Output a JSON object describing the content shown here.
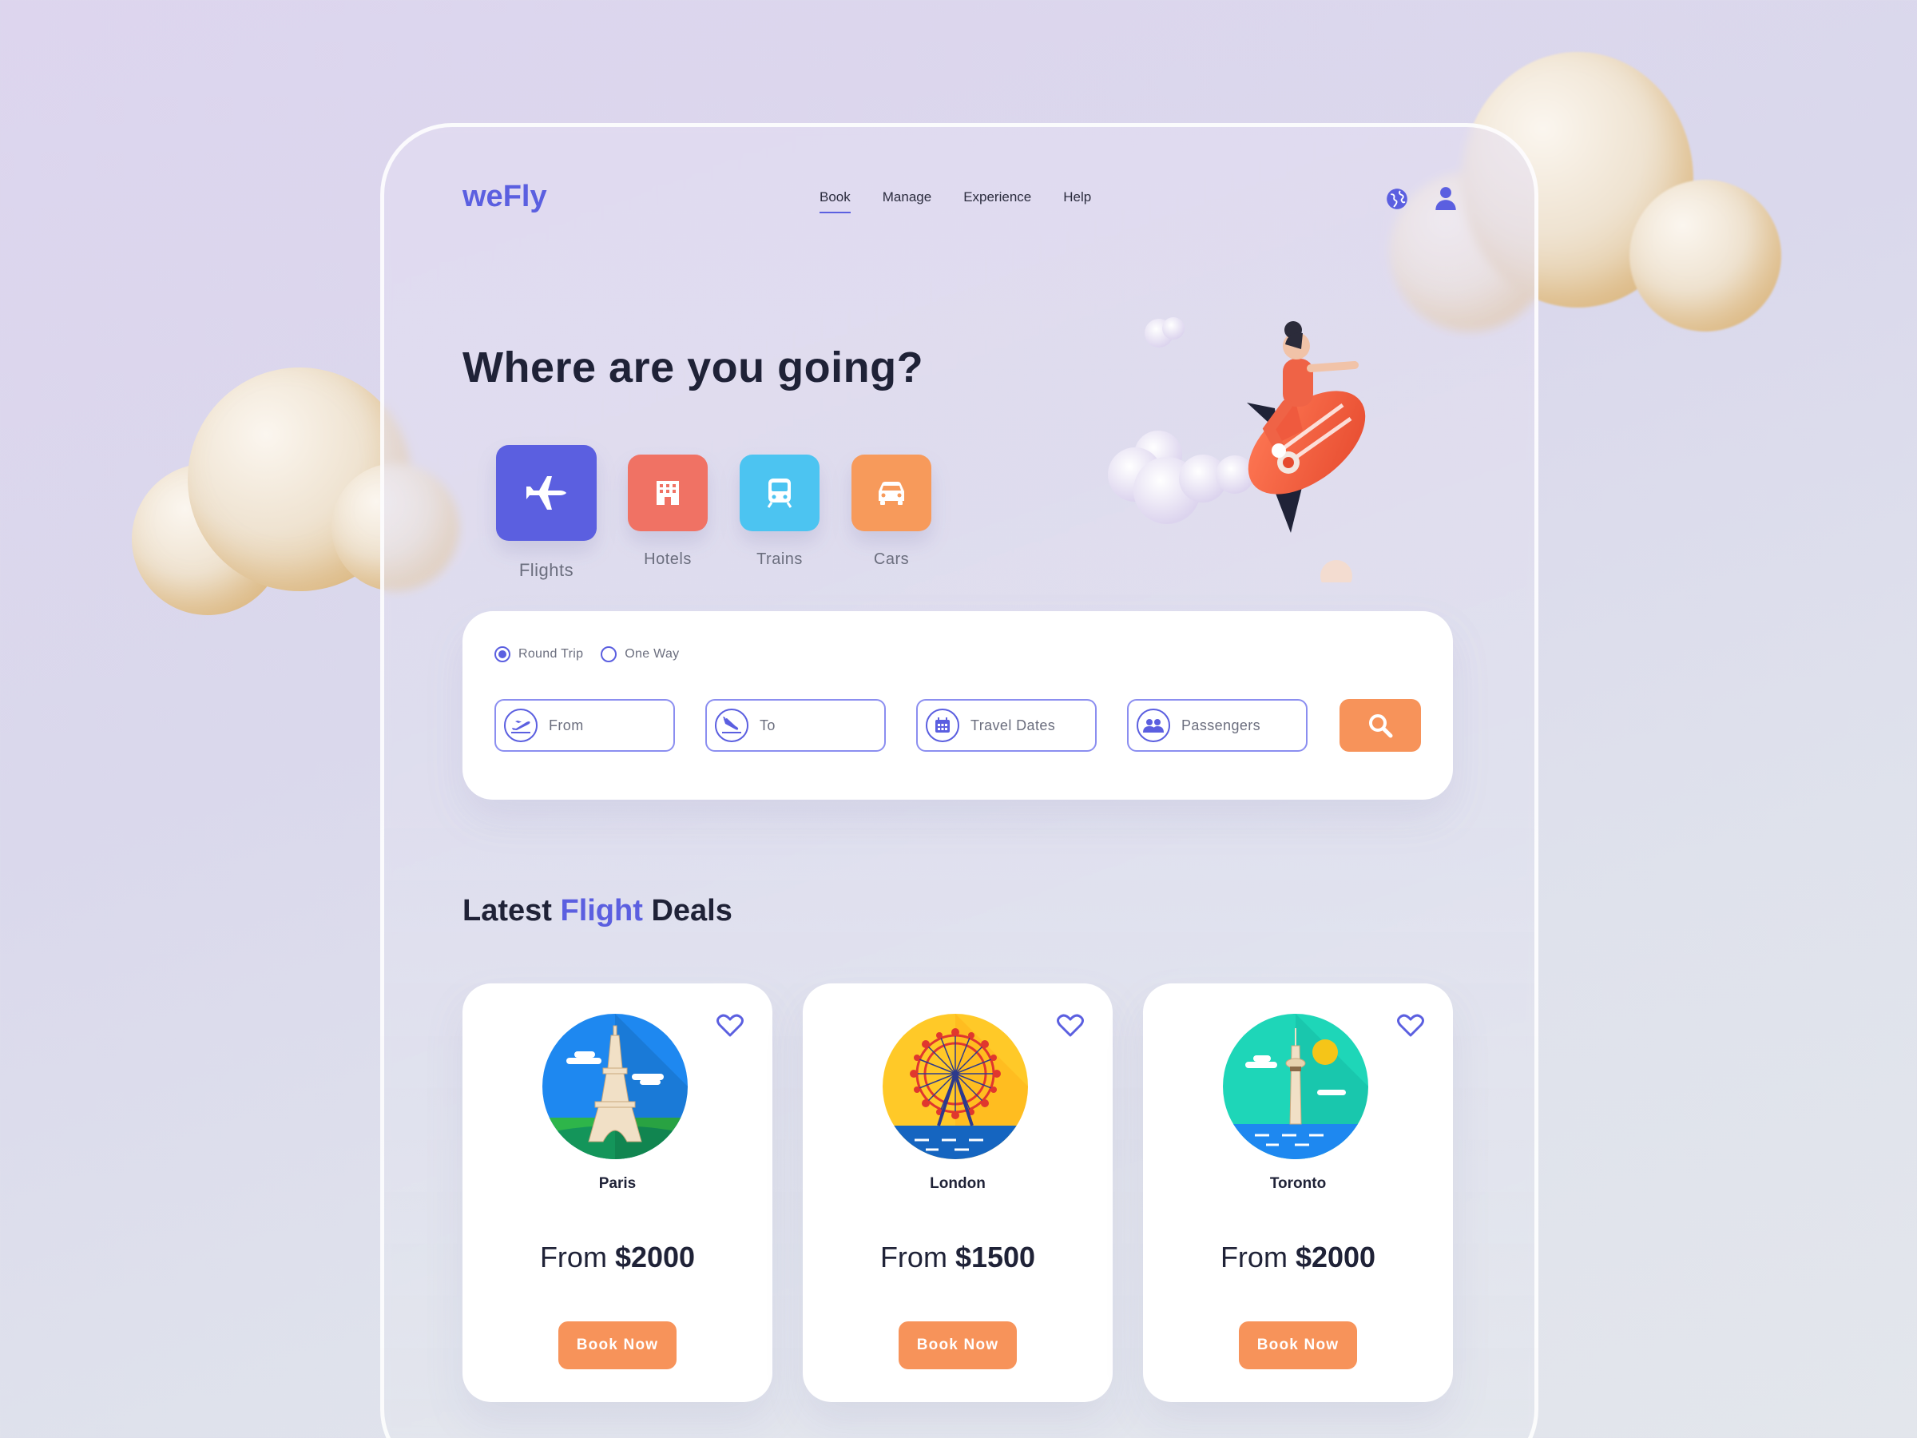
{
  "brand": {
    "logo": "weFly",
    "accent": "#5b5fe0",
    "cta_color": "#f7935a"
  },
  "nav": {
    "items": [
      {
        "label": "Book",
        "active": true
      },
      {
        "label": "Manage",
        "active": false
      },
      {
        "label": "Experience",
        "active": false
      },
      {
        "label": "Help",
        "active": false
      }
    ],
    "icons": [
      "globe-icon",
      "user-icon"
    ]
  },
  "hero": {
    "title": "Where are you going?"
  },
  "categories": [
    {
      "label": "Flights",
      "icon": "plane-icon",
      "color": "#5b5fe0",
      "selected": true
    },
    {
      "label": "Hotels",
      "icon": "hotel-icon",
      "color": "#f07264",
      "selected": false
    },
    {
      "label": "Trains",
      "icon": "train-icon",
      "color": "#4cc4f1",
      "selected": false
    },
    {
      "label": "Cars",
      "icon": "car-icon",
      "color": "#f79a5b",
      "selected": false
    }
  ],
  "search": {
    "trip_types": [
      {
        "label": "Round Trip",
        "checked": true
      },
      {
        "label": "One Way",
        "checked": false
      }
    ],
    "fields": [
      {
        "placeholder": "From",
        "icon": "takeoff-icon"
      },
      {
        "placeholder": "To",
        "icon": "landing-icon"
      },
      {
        "placeholder": "Travel Dates",
        "icon": "calendar-icon"
      },
      {
        "placeholder": "Passengers",
        "icon": "passengers-icon"
      }
    ],
    "button_icon": "search-icon"
  },
  "deals": {
    "title_prefix": "Latest ",
    "title_accent": "Flight",
    "title_suffix": " Deals",
    "items": [
      {
        "city": "Paris",
        "price_prefix": "From ",
        "price": "$2000",
        "cta": "Book Now",
        "icon": "eiffel-tower-icon"
      },
      {
        "city": "London",
        "price_prefix": "From ",
        "price": "$1500",
        "cta": "Book Now",
        "icon": "london-eye-icon"
      },
      {
        "city": "Toronto",
        "price_prefix": "From ",
        "price": "$2000",
        "cta": "Book Now",
        "icon": "cn-tower-icon"
      }
    ]
  }
}
